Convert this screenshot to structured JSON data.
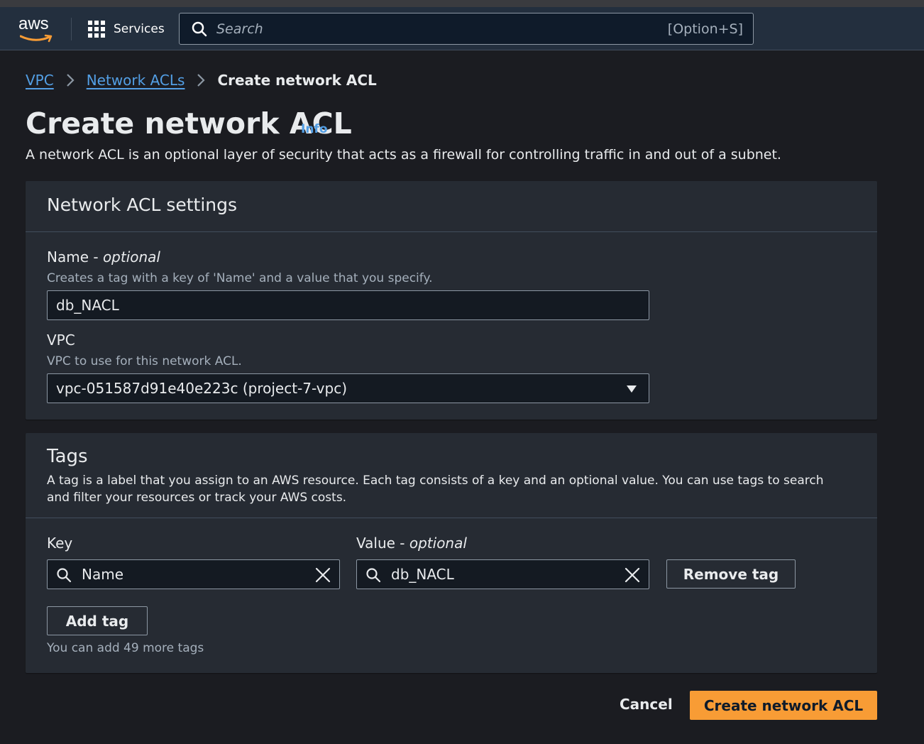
{
  "topnav": {
    "logo_text": "aws",
    "services_label": "Services",
    "search_placeholder": "Search",
    "search_shortcut": "[Option+S]"
  },
  "breadcrumb": {
    "items": [
      "VPC",
      "Network ACLs"
    ],
    "current": "Create network ACL"
  },
  "page": {
    "title": "Create network ACL",
    "info_label": "Info",
    "description": "A network ACL is an optional layer of security that acts as a firewall for controlling traffic in and out of a subnet."
  },
  "settings": {
    "heading": "Network ACL settings",
    "name_label": "Name - ",
    "name_label_optional": "optional",
    "name_hint": "Creates a tag with a key of 'Name' and a value that you specify.",
    "name_value": "db_NACL",
    "vpc_label": "VPC",
    "vpc_hint": "VPC to use for this network ACL.",
    "vpc_value": "vpc-051587d91e40e223c (project-7-vpc)"
  },
  "tags": {
    "heading": "Tags",
    "description": "A tag is a label that you assign to an AWS resource. Each tag consists of a key and an optional value. You can use tags to search and filter your resources or track your AWS costs.",
    "key_label": "Key",
    "value_label": "Value - ",
    "value_label_optional": "optional",
    "rows": [
      {
        "key": "Name",
        "value": "db_NACL"
      }
    ],
    "remove_label": "Remove tag",
    "add_label": "Add tag",
    "remaining_hint": "You can add 49 more tags"
  },
  "footer": {
    "cancel_label": "Cancel",
    "submit_label": "Create network ACL"
  },
  "colors": {
    "background": "#1b1c21",
    "topnav": "#232f3e",
    "link": "#539fe5",
    "primary": "#f89c35",
    "panel": "#262b33"
  }
}
